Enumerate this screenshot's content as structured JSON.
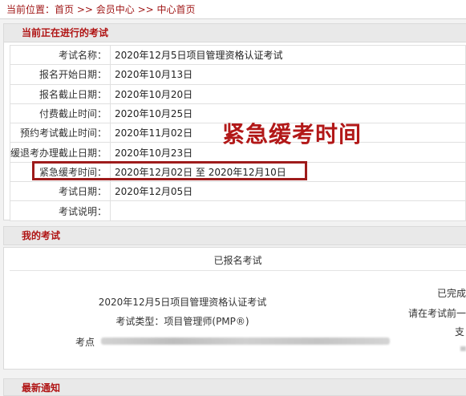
{
  "breadcrumb": {
    "prefix": "当前位置：",
    "home": "首页",
    "sep1": " >> ",
    "member": "会员中心",
    "sep2": " >> ",
    "center": "中心首页"
  },
  "current_exam": {
    "section_title": "当前正在进行的考试",
    "rows": [
      {
        "label": "考试名称：",
        "value": "2020年12月5日项目管理资格认证考试"
      },
      {
        "label": "报名开始日期：",
        "value": "2020年10月13日"
      },
      {
        "label": "报名截止日期：",
        "value": "2020年10月20日"
      },
      {
        "label": "付费截止时间：",
        "value": "2020年10月25日"
      },
      {
        "label": "预约考试截止时间：",
        "value": "2020年11月02日"
      },
      {
        "label": "缓退考办理截止日期：",
        "value": "2020年10月23日"
      },
      {
        "label": "紧急缓考时间：",
        "value": "2020年12月02日 至 2020年12月10日"
      },
      {
        "label": "考试日期：",
        "value": "2020年12月05日"
      },
      {
        "label": "考试说明：",
        "value": ""
      }
    ],
    "annotation": "紧急缓考时间"
  },
  "my_exam": {
    "section_title": "我的考试",
    "registered_title": "已报名考试",
    "exam_name": "2020年12月5日项目管理资格认证考试",
    "exam_type": "考试类型：项目管理师(PMP®)",
    "site_label": "考点",
    "status_partial": "已完成",
    "hint_partial": "请在考试前一",
    "pay_partial": "支"
  },
  "news": {
    "section_title": "最新通知"
  },
  "colors": {
    "accent": "#b01414",
    "highlight_border": "#9e1b1b"
  }
}
